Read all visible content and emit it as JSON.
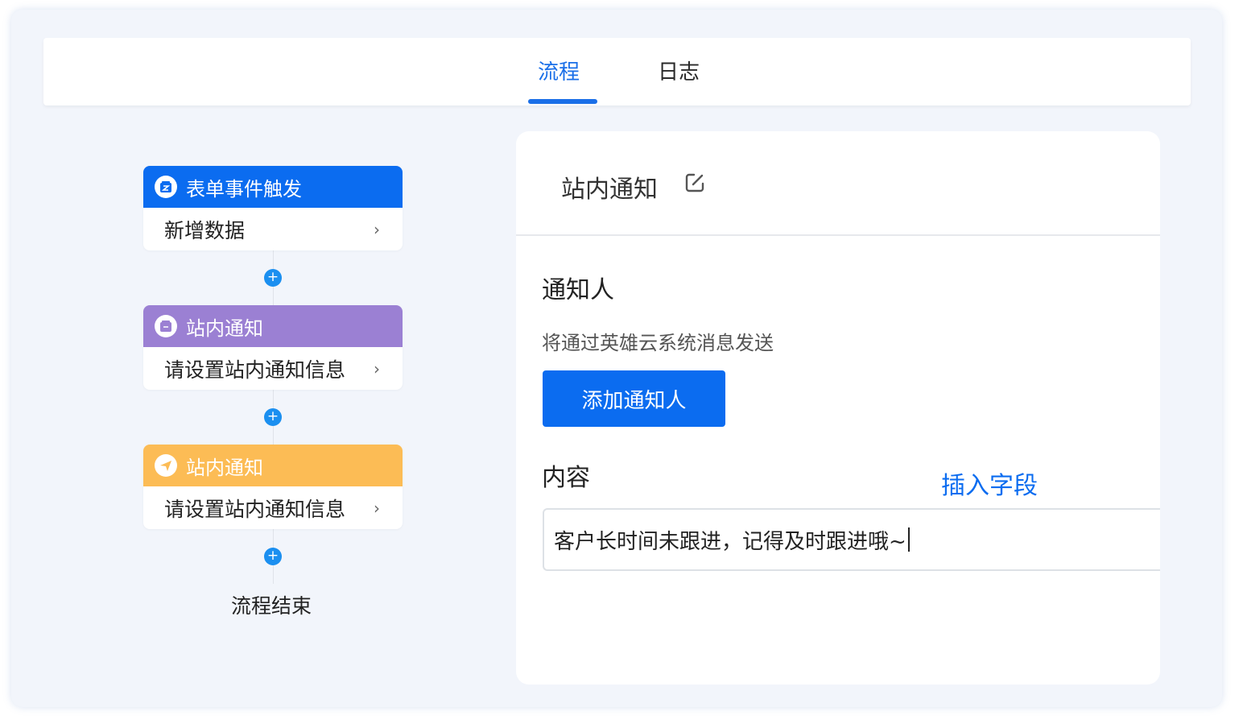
{
  "tabs": {
    "flow": "流程",
    "log": "日志"
  },
  "flow": {
    "nodes": [
      {
        "title": "表单事件触发",
        "body": "新增数据",
        "color": "#0b6cf0",
        "icon": "form-icon"
      },
      {
        "title": "站内通知",
        "body": "请设置站内通知信息",
        "color": "#9b80d3",
        "icon": "form-icon"
      },
      {
        "title": "站内通知",
        "body": "请设置站内通知信息",
        "color": "#fcbc55",
        "icon": "paper-plane-icon"
      }
    ],
    "add_symbol": "+",
    "chevron": "›",
    "end_label": "流程结束"
  },
  "panel": {
    "title": "站内通知",
    "recipients_label": "通知人",
    "recipients_hint": "将通过英雄云系统消息发送",
    "add_recipient_button": "添加通知人",
    "content_label": "内容",
    "insert_field_link": "插入字段",
    "content_value": "客户长时间未跟进，记得及时跟进哦~"
  },
  "colors": {
    "accent": "#0b6cf0",
    "purple": "#9b80d3",
    "orange": "#fcbc55",
    "add_button": "#1b8ff0"
  }
}
